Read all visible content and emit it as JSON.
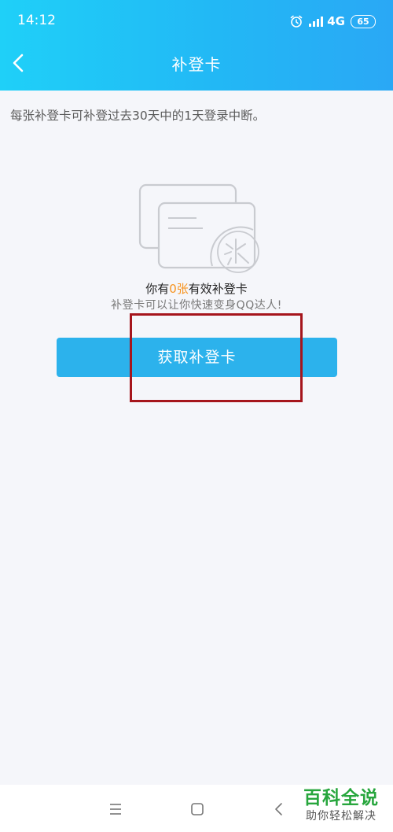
{
  "status_bar": {
    "time": "14:12",
    "network": "4G",
    "battery": "65",
    "icons": [
      "alarm-icon",
      "signal-icon",
      "battery-icon"
    ]
  },
  "header": {
    "title": "补登卡",
    "back_icon": "back-arrow-icon"
  },
  "description": "每张补登卡可补登过去30天中的1天登录中断。",
  "card_status": {
    "prefix": "你有",
    "count": "0张",
    "suffix": "有效补登卡",
    "subtitle": "补登卡可以让你快速变身QQ达人!"
  },
  "button": {
    "label": "获取补登卡"
  },
  "nav_bar": {
    "icons": [
      "menu-icon",
      "home-icon",
      "back-icon"
    ]
  },
  "watermark": {
    "title": "百科全说",
    "subtitle": "助你轻松解决"
  },
  "colors": {
    "header_gradient_start": "#1fd0f8",
    "header_gradient_end": "#2aa8f5",
    "button": "#2cb2ec",
    "count_highlight": "#f7931e",
    "annotation_box": "#a5151c",
    "watermark_green": "#27a63d"
  }
}
